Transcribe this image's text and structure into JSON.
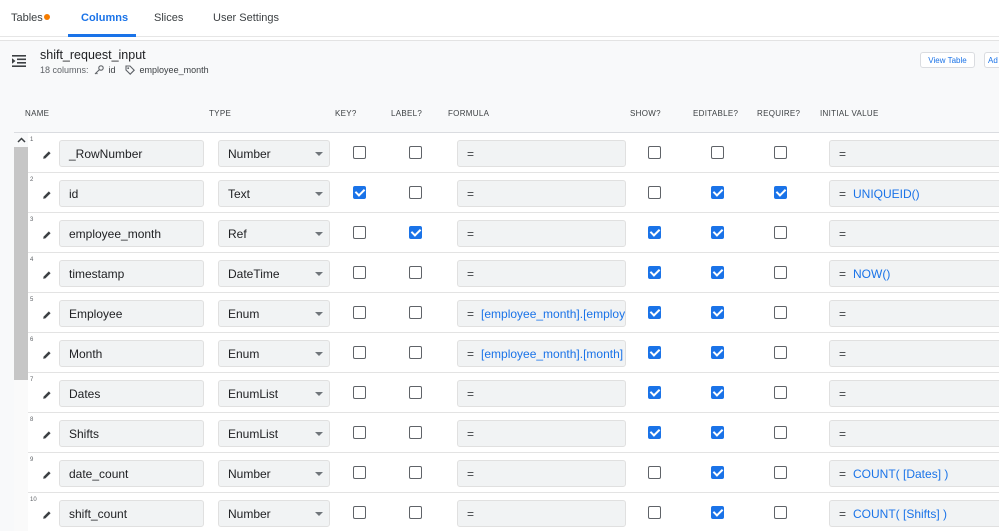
{
  "tabs": [
    {
      "label": "Tables",
      "has_dot": true
    },
    {
      "label": "Columns",
      "active": true
    },
    {
      "label": "Slices"
    },
    {
      "label": "User Settings"
    }
  ],
  "table": {
    "name": "shift_request_input",
    "columns_count": "18 columns:",
    "key": "id",
    "label": "employee_month",
    "view_table_btn": "View Table",
    "add_btn": "Ad"
  },
  "headers": {
    "name": "NAME",
    "type": "TYPE",
    "key": "KEY?",
    "label": "LABEL?",
    "formula": "FORMULA",
    "show": "SHOW?",
    "editable": "EDITABLE?",
    "require": "REQUIRE?",
    "initial": "INITIAL VALUE"
  },
  "colors": {
    "accent": "#1a73e8",
    "dot": "#f57c00"
  },
  "rows": [
    {
      "num": "1",
      "name": "_RowNumber",
      "type": "Number",
      "key": false,
      "label": false,
      "formula": "",
      "show": false,
      "editable": false,
      "require": false,
      "initial": ""
    },
    {
      "num": "2",
      "name": "id",
      "type": "Text",
      "key": true,
      "label": false,
      "formula": "",
      "show": false,
      "editable": true,
      "require": true,
      "initial": "UNIQUEID()"
    },
    {
      "num": "3",
      "name": "employee_month",
      "type": "Ref",
      "key": false,
      "label": true,
      "formula": "",
      "show": true,
      "editable": true,
      "require": false,
      "initial": ""
    },
    {
      "num": "4",
      "name": "timestamp",
      "type": "DateTime",
      "key": false,
      "label": false,
      "formula": "",
      "show": true,
      "editable": true,
      "require": false,
      "initial": "NOW()"
    },
    {
      "num": "5",
      "name": "Employee",
      "type": "Enum",
      "key": false,
      "label": false,
      "formula": "[employee_month].[employe",
      "show": true,
      "editable": true,
      "require": false,
      "initial": ""
    },
    {
      "num": "6",
      "name": "Month",
      "type": "Enum",
      "key": false,
      "label": false,
      "formula": "[employee_month].[month]",
      "show": true,
      "editable": true,
      "require": false,
      "initial": ""
    },
    {
      "num": "7",
      "name": "Dates",
      "type": "EnumList",
      "key": false,
      "label": false,
      "formula": "",
      "show": true,
      "editable": true,
      "require": false,
      "initial": ""
    },
    {
      "num": "8",
      "name": "Shifts",
      "type": "EnumList",
      "key": false,
      "label": false,
      "formula": "",
      "show": true,
      "editable": true,
      "require": false,
      "initial": ""
    },
    {
      "num": "9",
      "name": "date_count",
      "type": "Number",
      "key": false,
      "label": false,
      "formula": "",
      "show": false,
      "editable": true,
      "require": false,
      "initial": "COUNT( [Dates] )"
    },
    {
      "num": "10",
      "name": "shift_count",
      "type": "Number",
      "key": false,
      "label": false,
      "formula": "",
      "show": false,
      "editable": true,
      "require": false,
      "initial": "COUNT( [Shifts] )"
    }
  ]
}
